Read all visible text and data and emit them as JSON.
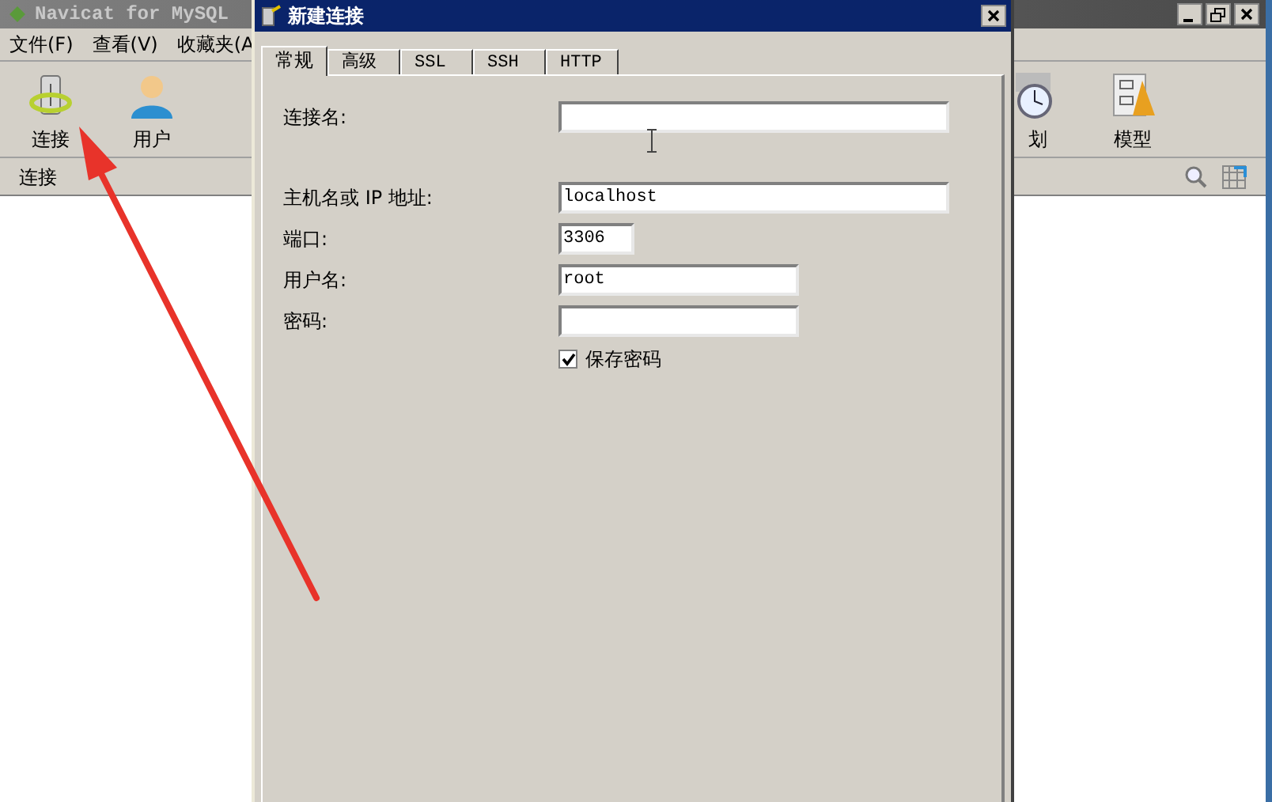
{
  "main_window": {
    "title": "Navicat for MySQL",
    "menu": [
      "文件(F)",
      "查看(V)",
      "收藏夹(A"
    ],
    "toolbar_left": [
      {
        "label": "连接",
        "kind": "connection"
      },
      {
        "label": "用户",
        "kind": "user"
      }
    ],
    "toolbar_right": [
      {
        "label": "划",
        "kind": "schedule"
      },
      {
        "label": "模型",
        "kind": "model"
      }
    ],
    "panel_header": "连接"
  },
  "dialog": {
    "title": "新建连接",
    "tabs": [
      {
        "label": "常规",
        "selected": true
      },
      {
        "label": "高级",
        "selected": false
      },
      {
        "label": "SSL",
        "selected": false
      },
      {
        "label": "SSH",
        "selected": false
      },
      {
        "label": "HTTP",
        "selected": false
      }
    ],
    "fields": [
      {
        "label": "连接名:",
        "kind": "wide"
      },
      {
        "label": "主机名或 IP 地址:",
        "value": "localhost",
        "kind": "wide"
      },
      {
        "label": "端口:",
        "value": "3306",
        "kind": "port"
      },
      {
        "label": "用户名:",
        "value": "root",
        "kind": "medium"
      },
      {
        "label": "密码:",
        "kind": "medium"
      }
    ],
    "save_password": {
      "label": "保存密码",
      "checked": true
    }
  }
}
